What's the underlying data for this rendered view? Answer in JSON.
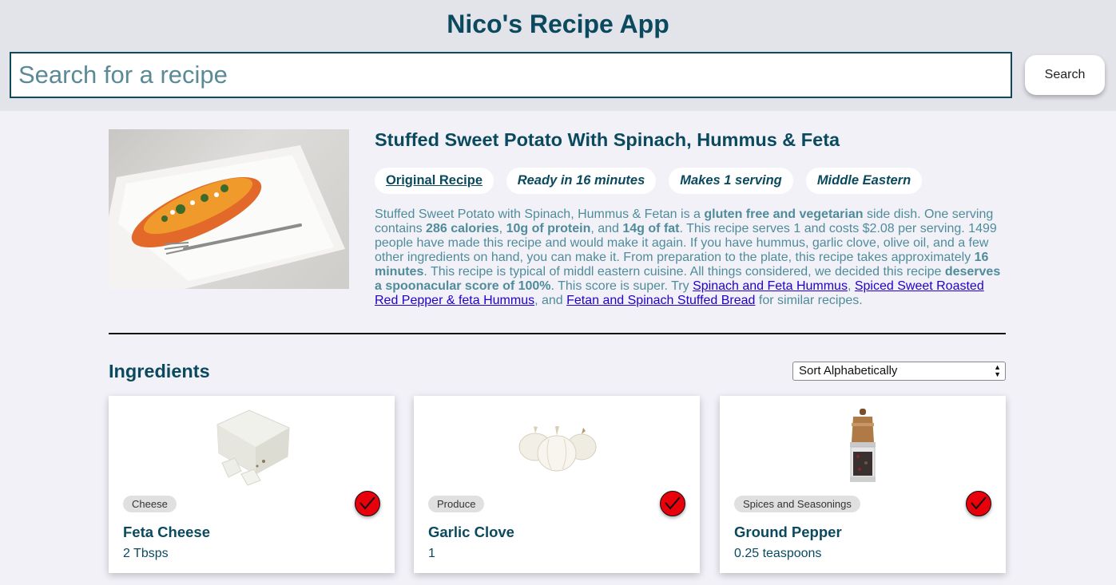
{
  "header": {
    "title": "Nico's Recipe App",
    "search_placeholder": "Search for a recipe",
    "search_button": "Search"
  },
  "recipe": {
    "title": "Stuffed Sweet Potato With Spinach, Hummus & Feta",
    "pills": {
      "original": "Original Recipe",
      "ready": "Ready in 16 minutes",
      "servings": "Makes 1 serving",
      "cuisine": "Middle Eastern"
    },
    "summary": {
      "s1": "Stuffed Sweet Potato with Spinach, Hummus & Fetan is a ",
      "b1": "gluten free and vegetarian",
      "s2": " side dish. One serving contains ",
      "b2": "286 calories",
      "s3": ", ",
      "b3": "10g of protein",
      "s4": ", and ",
      "b4": "14g of fat",
      "s5": ". This recipe serves 1 and costs $2.08 per serving. 1499 people have made this recipe and would make it again. If you have hummus, garlic clove, olive oil, and a few other ingredients on hand, you can make it. From preparation to the plate, this recipe takes approximately ",
      "b5": "16 minutes",
      "s6": ". This recipe is typical of middl eastern cuisine. All things considered, we decided this recipe ",
      "b6": "deserves a spoonacular score of 100%",
      "s7": ". This score is super. Try ",
      "link1": "Spinach and Feta Hummus",
      "s8": ", ",
      "link2": "Spiced Sweet Roasted Red Pepper & feta Hummus",
      "s9": ", and ",
      "link3": "Fetan and Spinach Stuffed Bread",
      "s10": " for similar recipes."
    }
  },
  "ingredients": {
    "title": "Ingredients",
    "sort_selected": "Sort Alphabetically",
    "items": [
      {
        "category": "Cheese",
        "name": "Feta Cheese",
        "amount": "2 Tbsps",
        "icon": "feta-cheese-image"
      },
      {
        "category": "Produce",
        "name": "Garlic Clove",
        "amount": "1",
        "icon": "garlic-image"
      },
      {
        "category": "Spices and Seasonings",
        "name": "Ground Pepper",
        "amount": "0.25 teaspoons",
        "icon": "pepper-grinder-image"
      }
    ]
  },
  "colors": {
    "primary": "#0b4a5e",
    "summary_text": "#4f8c9b",
    "link": "#2200cc",
    "check_red": "#e8000b",
    "header_bg": "#e3e3ea",
    "page_bg": "#f2f1f8"
  }
}
